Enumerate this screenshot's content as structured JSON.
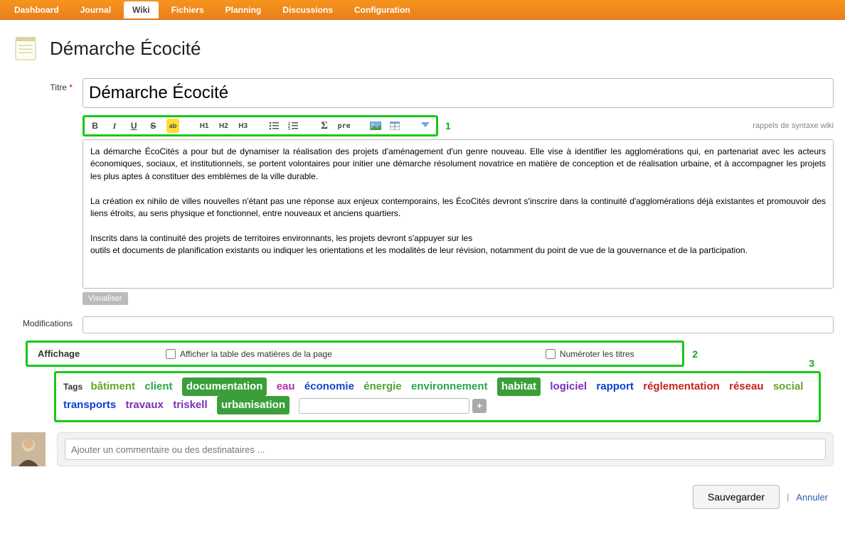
{
  "nav": {
    "tabs": [
      "Dashboard",
      "Journal",
      "Wiki",
      "Fichiers",
      "Planning",
      "Discussions",
      "Configuration"
    ],
    "active": "Wiki"
  },
  "page": {
    "title": "Démarche Écocité"
  },
  "form": {
    "titre_label": "Titre",
    "titre_value": "Démarche Écocité",
    "syntax_hint": "rappels de syntaxe wiki",
    "body": "La démarche ÉcoCités a pour but de dynamiser la réalisation des projets d'aménagement d'un genre nouveau. Elle vise à identifier les agglomérations qui, en partenariat avec les acteurs économiques, sociaux, et institutionnels, se portent volontaires pour initier une démarche résolument novatrice en matière de conception et de réalisation urbaine, et à accompagner les projets les plus aptes à constituer des emblèmes de la ville durable.\n\nLa création ex nihilo de villes nouvelles n'étant pas une réponse aux enjeux contemporains, les ÉcoCités devront s'inscrire dans la continuité d'agglomérations déjà existantes et promouvoir des liens étroits, au sens physique et fonctionnel, entre nouveaux et anciens quartiers.\n\nInscrits dans la continuité des projets de territoires environnants, les projets devront s'appuyer sur les\noutils et documents de planification existants ou indiquer les orientations et les modalités de leur révision, notamment du point de vue de la gouvernance et de la participation.",
    "visualiser": "Visualiser",
    "modifications_label": "Modifications",
    "modifications_value": ""
  },
  "toolbar": {
    "buttons": [
      "B",
      "I",
      "U",
      "S",
      "ab",
      "H1",
      "H2",
      "H3",
      "ul",
      "ol",
      "Σ",
      "pre",
      "img",
      "tbl",
      "more"
    ]
  },
  "affichage": {
    "label": "Affichage",
    "opt_toc": "Afficher la table des matières de la page",
    "opt_num": "Numéroter les titres"
  },
  "tags": {
    "label": "Tags",
    "items": [
      {
        "text": "bâtiment",
        "color": "#6aa22a",
        "selected": false
      },
      {
        "text": "client",
        "color": "#2aa54a",
        "selected": false
      },
      {
        "text": "documentation",
        "color": "#3a9f3a",
        "selected": true
      },
      {
        "text": "eau",
        "color": "#b12fb1",
        "selected": false
      },
      {
        "text": "économie",
        "color": "#1646c9",
        "selected": false
      },
      {
        "text": "énergie",
        "color": "#4aa62a",
        "selected": false
      },
      {
        "text": "environnement",
        "color": "#2aa54a",
        "selected": false
      },
      {
        "text": "habitat",
        "color": "#3a9f3a",
        "selected": true
      },
      {
        "text": "logiciel",
        "color": "#7a2fb1",
        "selected": false
      },
      {
        "text": "rapport",
        "color": "#0a3fcf",
        "selected": false
      },
      {
        "text": "réglementation",
        "color": "#c4231e",
        "selected": false
      },
      {
        "text": "réseau",
        "color": "#c4231e",
        "selected": false
      },
      {
        "text": "social",
        "color": "#6aa22a",
        "selected": false
      },
      {
        "text": "transports",
        "color": "#0a3fcf",
        "selected": false
      },
      {
        "text": "travaux",
        "color": "#7a2fb1",
        "selected": false
      },
      {
        "text": "triskell",
        "color": "#7a2fb1",
        "selected": false
      },
      {
        "text": "urbanisation",
        "color": "#3a9f3a",
        "selected": true
      }
    ]
  },
  "comment": {
    "placeholder": "Ajouter un commentaire ou des destinataires ..."
  },
  "actions": {
    "save": "Sauvegarder",
    "cancel": "Annuler"
  },
  "callouts": {
    "one": "1",
    "two": "2",
    "three": "3"
  }
}
